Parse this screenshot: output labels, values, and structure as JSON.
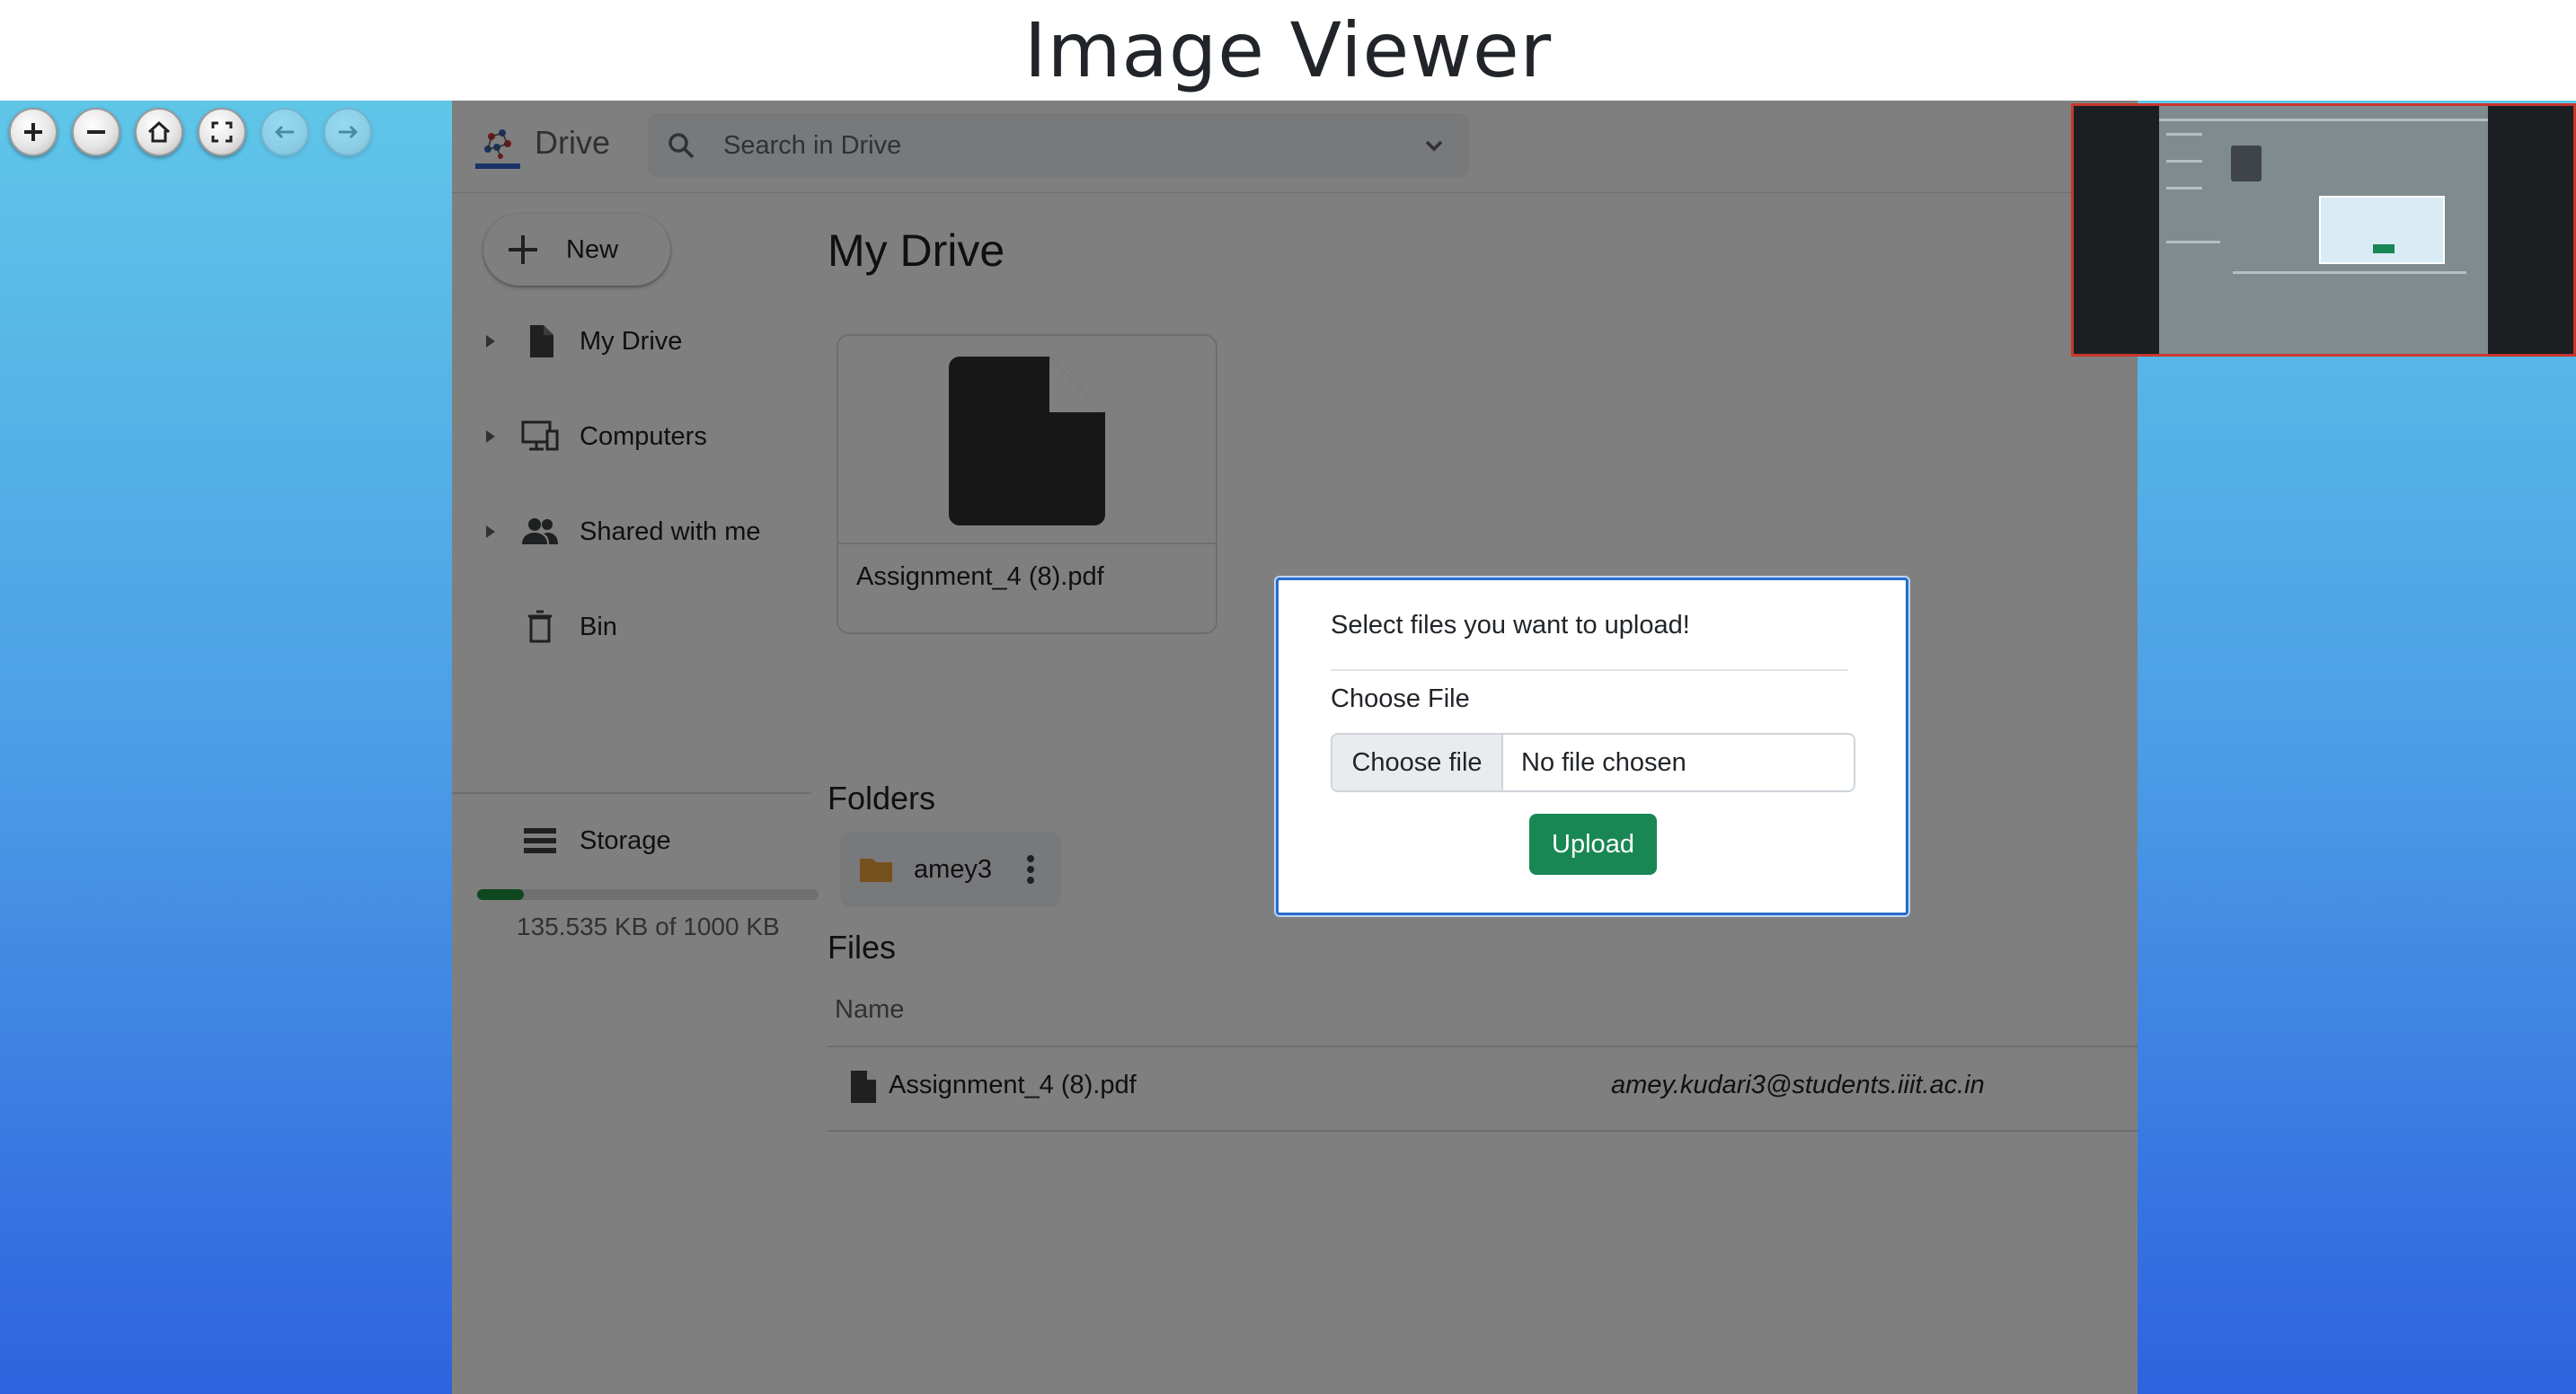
{
  "header": {
    "title": "Image Viewer"
  },
  "viewer_nav": [
    {
      "name": "zoom-in-button",
      "icon": "plus-icon",
      "enabled": true
    },
    {
      "name": "zoom-out-button",
      "icon": "minus-icon",
      "enabled": true
    },
    {
      "name": "home-button",
      "icon": "home-icon",
      "enabled": true
    },
    {
      "name": "fullscreen-button",
      "icon": "fullscreen-icon",
      "enabled": true
    },
    {
      "name": "previous-button",
      "icon": "arrow-left-icon",
      "enabled": false
    },
    {
      "name": "next-button",
      "icon": "arrow-right-icon",
      "enabled": false
    }
  ],
  "app": {
    "brand": "Drive",
    "search_placeholder": "Search in Drive",
    "new_label": "New",
    "sidebar": {
      "items": [
        {
          "label": "My Drive",
          "icon": "file-icon",
          "expandable": true
        },
        {
          "label": "Computers",
          "icon": "computer-icon",
          "expandable": true
        },
        {
          "label": "Shared with me",
          "icon": "people-icon",
          "expandable": true
        },
        {
          "label": "Bin",
          "icon": "trash-icon",
          "expandable": false
        },
        {
          "label": "Storage",
          "icon": "storage-icon",
          "expandable": false
        }
      ],
      "storage_text": "135.535 KB of 1000 KB",
      "storage_used_fraction": 0.135535
    },
    "main": {
      "title": "My Drive",
      "card_file_name": "Assignment_4 (8).pdf",
      "folders_label": "Folders",
      "folders": [
        {
          "name": "amey3"
        }
      ],
      "files_label": "Files",
      "table_header_name": "Name",
      "files": [
        {
          "name": "Assignment_4 (8).pdf",
          "owner": "amey.kudari3@students.iiit.ac.in"
        }
      ]
    }
  },
  "modal": {
    "title": "Select files you want to upload!",
    "field_label": "Choose File",
    "choose_button": "Choose file",
    "file_value": "No file chosen",
    "upload_button": "Upload"
  },
  "colors": {
    "accent_green": "#198754",
    "modal_border": "#2a6cc9",
    "thumbnail_border": "#c8372d"
  }
}
